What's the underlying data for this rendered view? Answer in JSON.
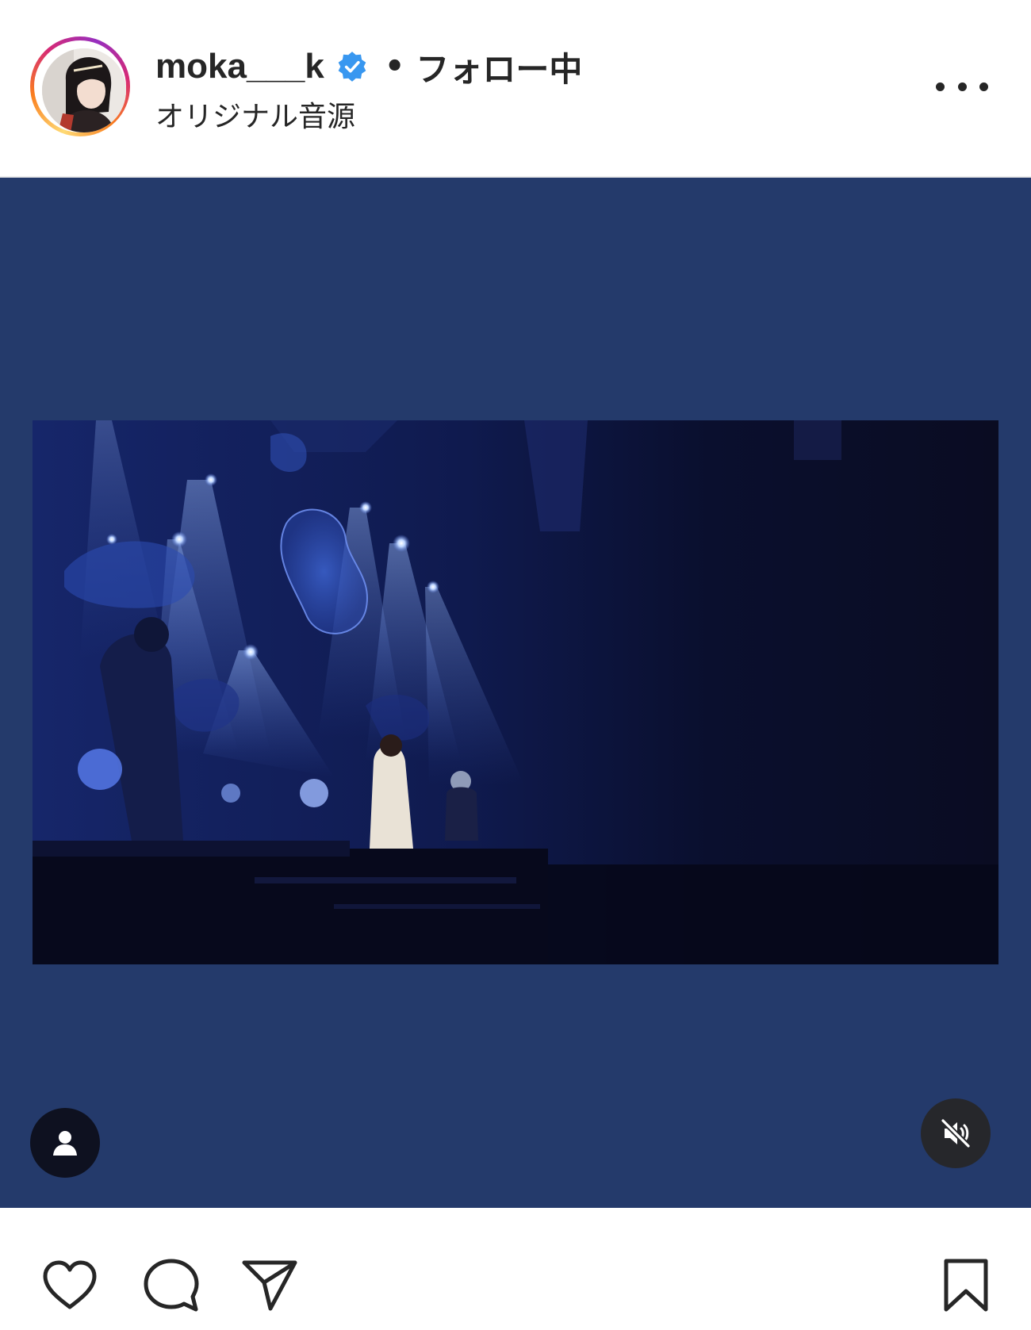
{
  "post": {
    "username": "moka___k",
    "verified": true,
    "separator": "•",
    "follow_status": "フォロー中",
    "audio": "オリジナル音源"
  },
  "media": {
    "background_color": "#243a6b",
    "content": "concert-stage-video",
    "muted": true
  },
  "icons": {
    "more": "more-options-icon",
    "tag": "user-tag-icon",
    "mute": "muted-speaker-icon",
    "like": "heart-icon",
    "comment": "comment-bubble-icon",
    "share": "paper-plane-icon",
    "save": "bookmark-icon"
  },
  "colors": {
    "verified_badge": "#3897f0",
    "text": "#262626"
  }
}
